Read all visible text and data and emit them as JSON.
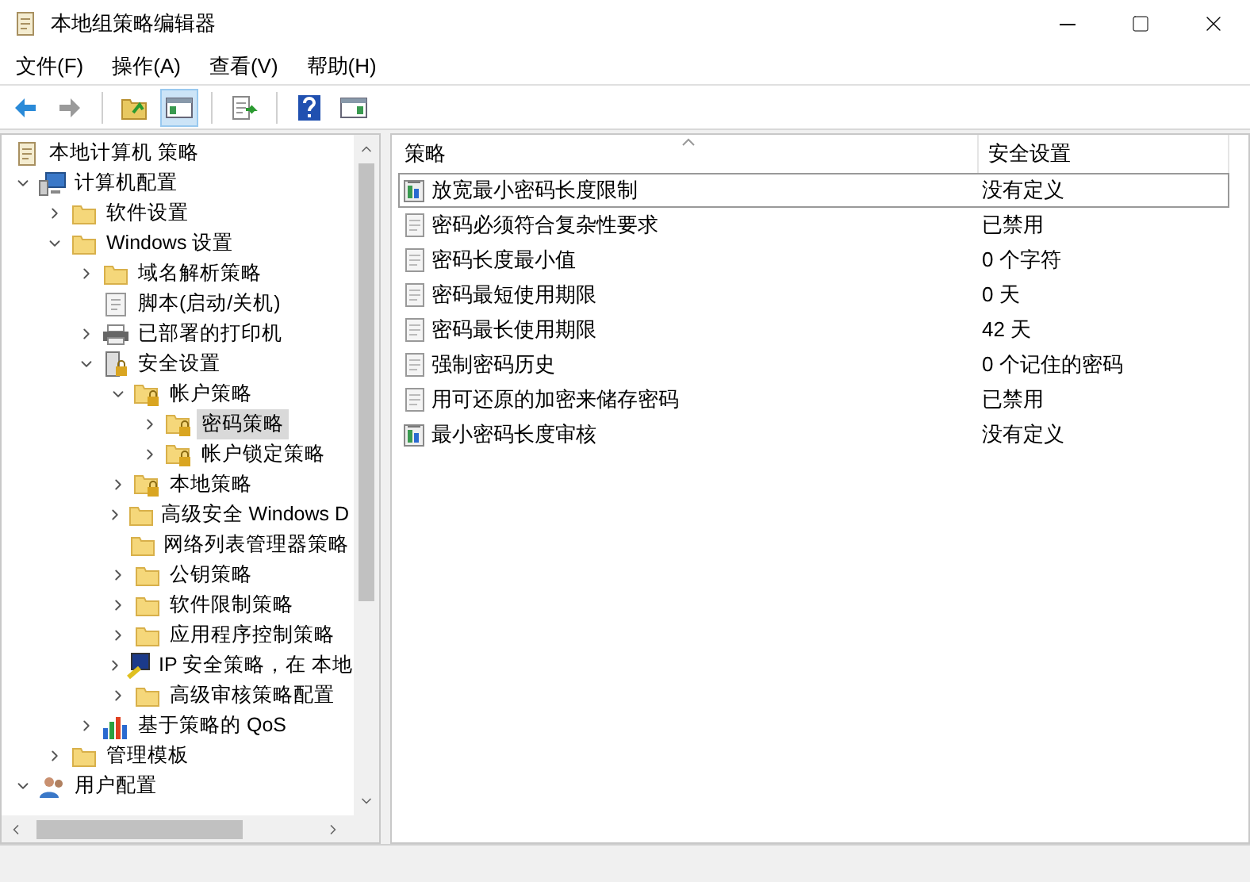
{
  "window": {
    "title": "本地组策略编辑器"
  },
  "menu": [
    "文件(F)",
    "操作(A)",
    "查看(V)",
    "帮助(H)"
  ],
  "toolbar": [
    {
      "kind": "back",
      "disabled": false
    },
    {
      "kind": "forward",
      "disabled": true
    },
    {
      "kind": "sep"
    },
    {
      "kind": "up",
      "pressed": false
    },
    {
      "kind": "tree",
      "pressed": true
    },
    {
      "kind": "sep"
    },
    {
      "kind": "export",
      "pressed": false
    },
    {
      "kind": "sep"
    },
    {
      "kind": "help",
      "pressed": false
    },
    {
      "kind": "pane",
      "pressed": false
    }
  ],
  "tree": [
    {
      "label": "本地计算机 策略",
      "kind": "policy",
      "children": [
        {
          "label": "计算机配置",
          "kind": "computer",
          "expanded": true,
          "children": [
            {
              "label": "软件设置",
              "kind": "folder",
              "expanded": false
            },
            {
              "label": "Windows 设置",
              "kind": "folder",
              "expanded": true,
              "children": [
                {
                  "label": "域名解析策略",
                  "kind": "folder",
                  "expanded": false
                },
                {
                  "label": "脚本(启动/关机)",
                  "kind": "script"
                },
                {
                  "label": "已部署的打印机",
                  "kind": "printer",
                  "expanded": false
                },
                {
                  "label": "安全设置",
                  "kind": "security",
                  "expanded": true,
                  "children": [
                    {
                      "label": "帐户策略",
                      "kind": "lockfolder",
                      "expanded": true,
                      "children": [
                        {
                          "label": "密码策略",
                          "kind": "lockfolder",
                          "expanded": false,
                          "selected": true
                        },
                        {
                          "label": "帐户锁定策略",
                          "kind": "lockfolder",
                          "expanded": false,
                          "selected": false
                        }
                      ]
                    },
                    {
                      "label": "本地策略",
                      "kind": "lockfolder",
                      "expanded": false
                    },
                    {
                      "label": "高级安全 Windows D",
                      "kind": "folder",
                      "expanded": false
                    },
                    {
                      "label": "网络列表管理器策略",
                      "kind": "folder"
                    },
                    {
                      "label": "公钥策略",
                      "kind": "folder",
                      "expanded": false
                    },
                    {
                      "label": "软件限制策略",
                      "kind": "folder",
                      "expanded": false
                    },
                    {
                      "label": "应用程序控制策略",
                      "kind": "folder",
                      "expanded": false
                    },
                    {
                      "label": "IP 安全策略，在 本地",
                      "kind": "ip",
                      "expanded": false
                    },
                    {
                      "label": "高级审核策略配置",
                      "kind": "folder",
                      "expanded": false
                    }
                  ]
                },
                {
                  "label": "基于策略的 QoS",
                  "kind": "qos",
                  "expanded": false
                }
              ]
            },
            {
              "label": "管理模板",
              "kind": "folder",
              "expanded": false
            }
          ]
        },
        {
          "label": "用户配置",
          "kind": "user",
          "expanded": true
        }
      ]
    }
  ],
  "table": {
    "columns": [
      "策略",
      "安全设置"
    ],
    "rows": [
      {
        "kind": "audit",
        "policy": "放宽最小密码长度限制",
        "setting": "没有定义",
        "focused": true
      },
      {
        "kind": "setting",
        "policy": "密码必须符合复杂性要求",
        "setting": "已禁用",
        "focused": false
      },
      {
        "kind": "setting",
        "policy": "密码长度最小值",
        "setting": "0 个字符",
        "focused": false
      },
      {
        "kind": "setting",
        "policy": "密码最短使用期限",
        "setting": "0 天",
        "focused": false
      },
      {
        "kind": "setting",
        "policy": "密码最长使用期限",
        "setting": "42 天",
        "focused": false
      },
      {
        "kind": "setting",
        "policy": "强制密码历史",
        "setting": "0 个记住的密码",
        "focused": false
      },
      {
        "kind": "setting",
        "policy": "用可还原的加密来储存密码",
        "setting": "已禁用",
        "focused": false
      },
      {
        "kind": "audit",
        "policy": "最小密码长度审核",
        "setting": "没有定义",
        "focused": false
      }
    ]
  }
}
